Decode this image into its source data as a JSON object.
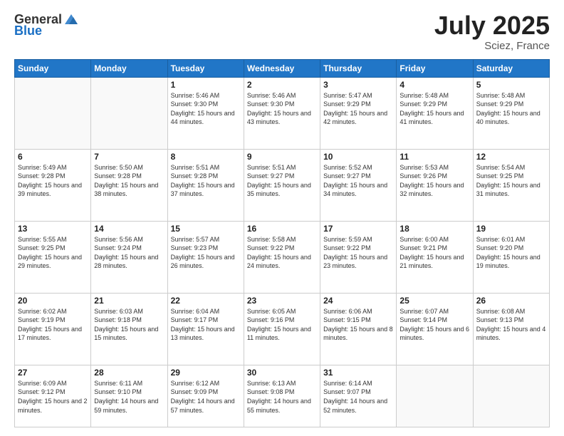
{
  "header": {
    "logo_general": "General",
    "logo_blue": "Blue",
    "month_year": "July 2025",
    "location": "Sciez, France"
  },
  "weekdays": [
    "Sunday",
    "Monday",
    "Tuesday",
    "Wednesday",
    "Thursday",
    "Friday",
    "Saturday"
  ],
  "weeks": [
    [
      {
        "day": "",
        "sunrise": "",
        "sunset": "",
        "daylight": ""
      },
      {
        "day": "",
        "sunrise": "",
        "sunset": "",
        "daylight": ""
      },
      {
        "day": "1",
        "sunrise": "Sunrise: 5:46 AM",
        "sunset": "Sunset: 9:30 PM",
        "daylight": "Daylight: 15 hours and 44 minutes."
      },
      {
        "day": "2",
        "sunrise": "Sunrise: 5:46 AM",
        "sunset": "Sunset: 9:30 PM",
        "daylight": "Daylight: 15 hours and 43 minutes."
      },
      {
        "day": "3",
        "sunrise": "Sunrise: 5:47 AM",
        "sunset": "Sunset: 9:29 PM",
        "daylight": "Daylight: 15 hours and 42 minutes."
      },
      {
        "day": "4",
        "sunrise": "Sunrise: 5:48 AM",
        "sunset": "Sunset: 9:29 PM",
        "daylight": "Daylight: 15 hours and 41 minutes."
      },
      {
        "day": "5",
        "sunrise": "Sunrise: 5:48 AM",
        "sunset": "Sunset: 9:29 PM",
        "daylight": "Daylight: 15 hours and 40 minutes."
      }
    ],
    [
      {
        "day": "6",
        "sunrise": "Sunrise: 5:49 AM",
        "sunset": "Sunset: 9:28 PM",
        "daylight": "Daylight: 15 hours and 39 minutes."
      },
      {
        "day": "7",
        "sunrise": "Sunrise: 5:50 AM",
        "sunset": "Sunset: 9:28 PM",
        "daylight": "Daylight: 15 hours and 38 minutes."
      },
      {
        "day": "8",
        "sunrise": "Sunrise: 5:51 AM",
        "sunset": "Sunset: 9:28 PM",
        "daylight": "Daylight: 15 hours and 37 minutes."
      },
      {
        "day": "9",
        "sunrise": "Sunrise: 5:51 AM",
        "sunset": "Sunset: 9:27 PM",
        "daylight": "Daylight: 15 hours and 35 minutes."
      },
      {
        "day": "10",
        "sunrise": "Sunrise: 5:52 AM",
        "sunset": "Sunset: 9:27 PM",
        "daylight": "Daylight: 15 hours and 34 minutes."
      },
      {
        "day": "11",
        "sunrise": "Sunrise: 5:53 AM",
        "sunset": "Sunset: 9:26 PM",
        "daylight": "Daylight: 15 hours and 32 minutes."
      },
      {
        "day": "12",
        "sunrise": "Sunrise: 5:54 AM",
        "sunset": "Sunset: 9:25 PM",
        "daylight": "Daylight: 15 hours and 31 minutes."
      }
    ],
    [
      {
        "day": "13",
        "sunrise": "Sunrise: 5:55 AM",
        "sunset": "Sunset: 9:25 PM",
        "daylight": "Daylight: 15 hours and 29 minutes."
      },
      {
        "day": "14",
        "sunrise": "Sunrise: 5:56 AM",
        "sunset": "Sunset: 9:24 PM",
        "daylight": "Daylight: 15 hours and 28 minutes."
      },
      {
        "day": "15",
        "sunrise": "Sunrise: 5:57 AM",
        "sunset": "Sunset: 9:23 PM",
        "daylight": "Daylight: 15 hours and 26 minutes."
      },
      {
        "day": "16",
        "sunrise": "Sunrise: 5:58 AM",
        "sunset": "Sunset: 9:22 PM",
        "daylight": "Daylight: 15 hours and 24 minutes."
      },
      {
        "day": "17",
        "sunrise": "Sunrise: 5:59 AM",
        "sunset": "Sunset: 9:22 PM",
        "daylight": "Daylight: 15 hours and 23 minutes."
      },
      {
        "day": "18",
        "sunrise": "Sunrise: 6:00 AM",
        "sunset": "Sunset: 9:21 PM",
        "daylight": "Daylight: 15 hours and 21 minutes."
      },
      {
        "day": "19",
        "sunrise": "Sunrise: 6:01 AM",
        "sunset": "Sunset: 9:20 PM",
        "daylight": "Daylight: 15 hours and 19 minutes."
      }
    ],
    [
      {
        "day": "20",
        "sunrise": "Sunrise: 6:02 AM",
        "sunset": "Sunset: 9:19 PM",
        "daylight": "Daylight: 15 hours and 17 minutes."
      },
      {
        "day": "21",
        "sunrise": "Sunrise: 6:03 AM",
        "sunset": "Sunset: 9:18 PM",
        "daylight": "Daylight: 15 hours and 15 minutes."
      },
      {
        "day": "22",
        "sunrise": "Sunrise: 6:04 AM",
        "sunset": "Sunset: 9:17 PM",
        "daylight": "Daylight: 15 hours and 13 minutes."
      },
      {
        "day": "23",
        "sunrise": "Sunrise: 6:05 AM",
        "sunset": "Sunset: 9:16 PM",
        "daylight": "Daylight: 15 hours and 11 minutes."
      },
      {
        "day": "24",
        "sunrise": "Sunrise: 6:06 AM",
        "sunset": "Sunset: 9:15 PM",
        "daylight": "Daylight: 15 hours and 8 minutes."
      },
      {
        "day": "25",
        "sunrise": "Sunrise: 6:07 AM",
        "sunset": "Sunset: 9:14 PM",
        "daylight": "Daylight: 15 hours and 6 minutes."
      },
      {
        "day": "26",
        "sunrise": "Sunrise: 6:08 AM",
        "sunset": "Sunset: 9:13 PM",
        "daylight": "Daylight: 15 hours and 4 minutes."
      }
    ],
    [
      {
        "day": "27",
        "sunrise": "Sunrise: 6:09 AM",
        "sunset": "Sunset: 9:12 PM",
        "daylight": "Daylight: 15 hours and 2 minutes."
      },
      {
        "day": "28",
        "sunrise": "Sunrise: 6:11 AM",
        "sunset": "Sunset: 9:10 PM",
        "daylight": "Daylight: 14 hours and 59 minutes."
      },
      {
        "day": "29",
        "sunrise": "Sunrise: 6:12 AM",
        "sunset": "Sunset: 9:09 PM",
        "daylight": "Daylight: 14 hours and 57 minutes."
      },
      {
        "day": "30",
        "sunrise": "Sunrise: 6:13 AM",
        "sunset": "Sunset: 9:08 PM",
        "daylight": "Daylight: 14 hours and 55 minutes."
      },
      {
        "day": "31",
        "sunrise": "Sunrise: 6:14 AM",
        "sunset": "Sunset: 9:07 PM",
        "daylight": "Daylight: 14 hours and 52 minutes."
      },
      {
        "day": "",
        "sunrise": "",
        "sunset": "",
        "daylight": ""
      },
      {
        "day": "",
        "sunrise": "",
        "sunset": "",
        "daylight": ""
      }
    ]
  ]
}
